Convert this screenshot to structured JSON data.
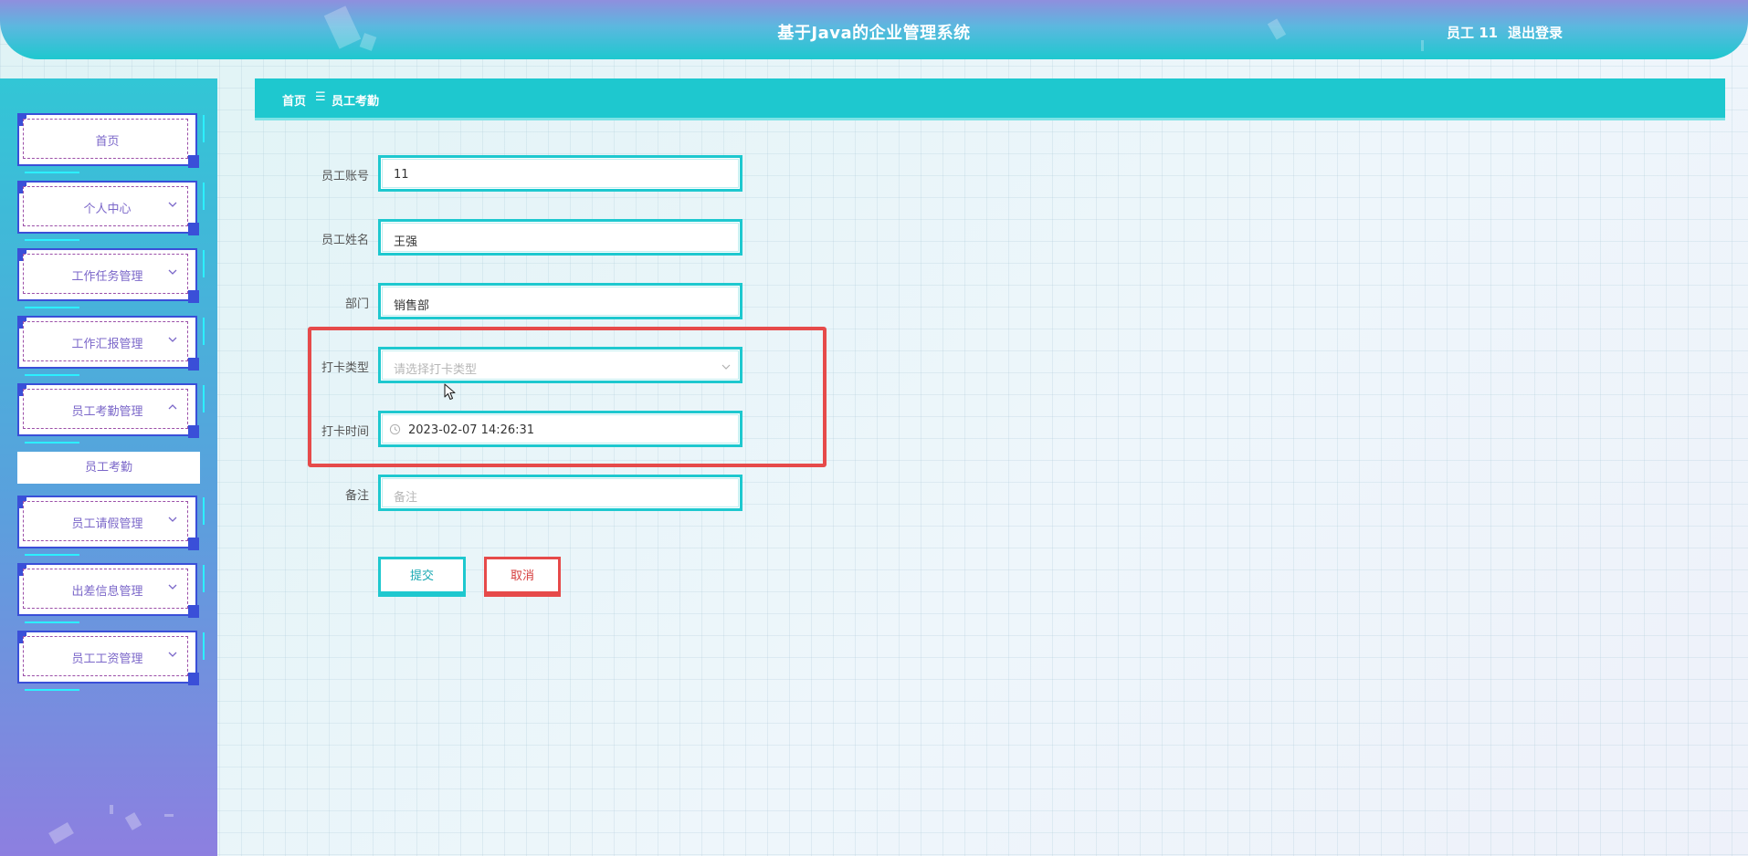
{
  "header": {
    "title": "基于Java的企业管理系统",
    "user": "员工 11",
    "logout": "退出登录"
  },
  "sidebar": {
    "items": [
      {
        "label": "首页",
        "icon": "none"
      },
      {
        "label": "个人中心",
        "icon": "chevron-down-icon"
      },
      {
        "label": "工作任务管理",
        "icon": "chevron-down-icon"
      },
      {
        "label": "工作汇报管理",
        "icon": "chevron-down-icon"
      },
      {
        "label": "员工考勤管理",
        "icon": "chevron-up-icon"
      },
      {
        "label": "员工请假管理",
        "icon": "chevron-down-icon"
      },
      {
        "label": "出差信息管理",
        "icon": "chevron-down-icon"
      },
      {
        "label": "员工工资管理",
        "icon": "chevron-down-icon"
      }
    ],
    "active_sub": "员工考勤"
  },
  "breadcrumb": {
    "home": "首页",
    "separator": "☰",
    "current": "员工考勤"
  },
  "form": {
    "account": {
      "label": "员工账号",
      "value": "11"
    },
    "name": {
      "label": "员工姓名",
      "value": "王强"
    },
    "dept": {
      "label": "部门",
      "value": "销售部"
    },
    "punch_type": {
      "label": "打卡类型",
      "placeholder": "请选择打卡类型"
    },
    "punch_time": {
      "label": "打卡时间",
      "value": "2023-02-07 14:26:31"
    },
    "remark": {
      "label": "备注",
      "placeholder": "备注"
    }
  },
  "buttons": {
    "submit": "提交",
    "cancel": "取消"
  },
  "colors": {
    "accent": "#1ec8cf",
    "highlight": "#e64a4a",
    "sidebar_frame": "#3a4fd8",
    "menu_text": "#7b67c9"
  }
}
